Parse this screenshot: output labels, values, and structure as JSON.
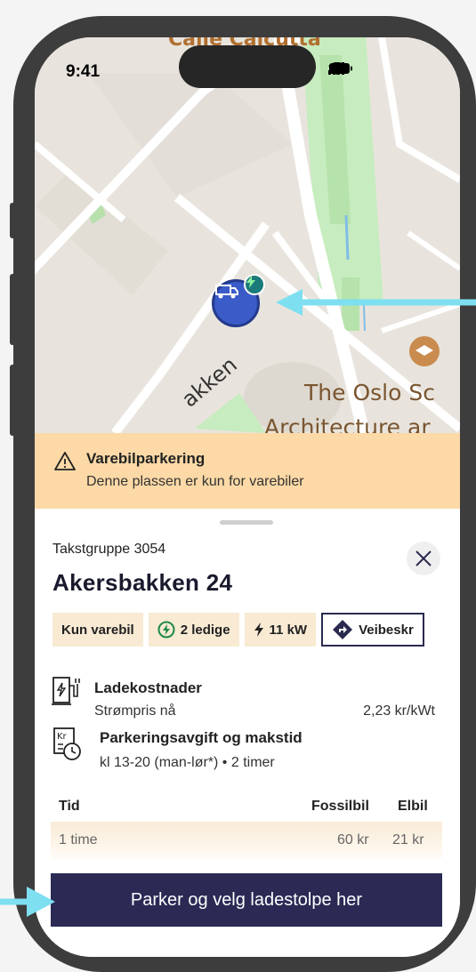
{
  "status_bar": {
    "time": "9:41"
  },
  "map": {
    "labels": {
      "top_street": "Calle Calcutta",
      "street_akk": "akken",
      "poi_line1": "The Oslo Sc",
      "poi_line2": "Architecture ar"
    }
  },
  "warning": {
    "title": "Varebilparkering",
    "subtitle": "Denne plassen er kun for varebiler"
  },
  "sheet": {
    "takstgruppe": "Takstgruppe 3054",
    "address": "Akersbakken 24",
    "chips": {
      "vehicle": "Kun varebil",
      "available": "2 ledige",
      "power": "11 kW",
      "directions": "Veibeskr"
    },
    "charging": {
      "title": "Ladekostnader",
      "price_label": "Strømpris nå",
      "price_value": "2,23 kr/kWt"
    },
    "parking": {
      "title": "Parkeringsavgift og makstid",
      "subtitle": "kl 13-20 (man-lør*) • 2 timer"
    },
    "table": {
      "headers": [
        "Tid",
        "Fossilbil",
        "Elbil"
      ],
      "rows": [
        [
          "1 time",
          "60 kr",
          "21 kr"
        ]
      ]
    },
    "cta": "Parker og velg ladestolpe her"
  },
  "colors": {
    "warning_bg": "#fcd9a6",
    "chip_bg": "#f8ead3",
    "primary": "#2a2a55",
    "marker": "#3b5bc9",
    "arrow": "#7ddff0",
    "charge_green": "#1e8a4a"
  }
}
